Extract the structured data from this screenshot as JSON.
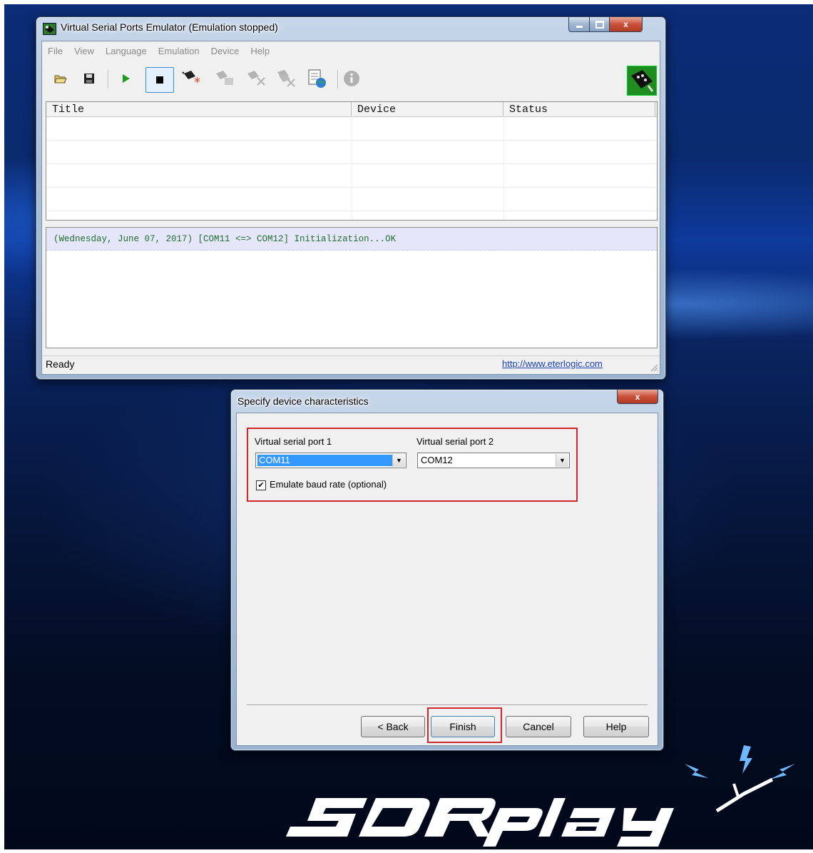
{
  "main_window": {
    "title": "Virtual Serial Ports Emulator (Emulation stopped)",
    "menu": [
      "File",
      "View",
      "Language",
      "Emulation",
      "Device",
      "Help"
    ],
    "table": {
      "columns": [
        "Title",
        "Device",
        "Status"
      ],
      "rows": []
    },
    "log": [
      "(Wednesday, June 07, 2017) [COM11 <=> COM12] Initialization...OK"
    ],
    "status": {
      "text": "Ready",
      "link": "http://www.eterlogic.com"
    }
  },
  "dialog": {
    "title": "Specify device characteristics",
    "port1": {
      "label": "Virtual serial port 1",
      "value": "COM11"
    },
    "port2": {
      "label": "Virtual serial port 2",
      "value": "COM12"
    },
    "baud_checkbox": {
      "label": "Emulate baud rate (optional)",
      "checked": true
    },
    "buttons": {
      "back": "< Back",
      "finish": "Finish",
      "cancel": "Cancel",
      "help": "Help"
    }
  },
  "close_glyph": "x"
}
